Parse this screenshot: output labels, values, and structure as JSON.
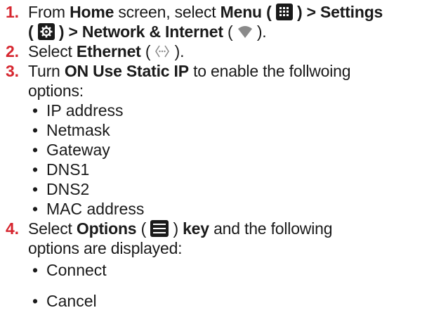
{
  "steps": [
    {
      "number": "1.",
      "line1": {
        "t1": "From ",
        "b1": "Home",
        "t2": " screen, select ",
        "b2": "Menu ( ",
        "b3": " ) > Settings"
      },
      "line2": {
        "b1": "( ",
        "b2": " ) > Network & Internet",
        "t1": " ( ",
        "t2": " )."
      }
    },
    {
      "number": "2.",
      "line1": {
        "t1": "Select ",
        "b1": "Ethernet",
        "t2": " ( ",
        "t3": " )."
      }
    },
    {
      "number": "3.",
      "line1": {
        "t1": "Turn ",
        "b1": "ON Use Static IP",
        "t2": " to enable the follwoing"
      },
      "line2": {
        "t1": "options:"
      },
      "bullets": [
        "IP address",
        "Netmask",
        "Gateway",
        "DNS1",
        "DNS2",
        "MAC address"
      ]
    },
    {
      "number": "4.",
      "line1": {
        "t1": "Select ",
        "b1": "Options",
        "t2": " ( ",
        "t3": " ) ",
        "b2": "key",
        "t4": " and the following"
      },
      "line2": {
        "t1": "options are displayed:"
      },
      "bullets": [
        "Connect",
        "Cancel"
      ]
    }
  ],
  "bullet_char": "•",
  "icons": {
    "menu": "menu-grid-icon",
    "settings": "gear-icon",
    "network": "wifi-icon",
    "ethernet": "ethernet-icon",
    "options": "options-list-icon"
  },
  "colors": {
    "step_number": "#d6262f",
    "text": "#1a1a1a"
  }
}
